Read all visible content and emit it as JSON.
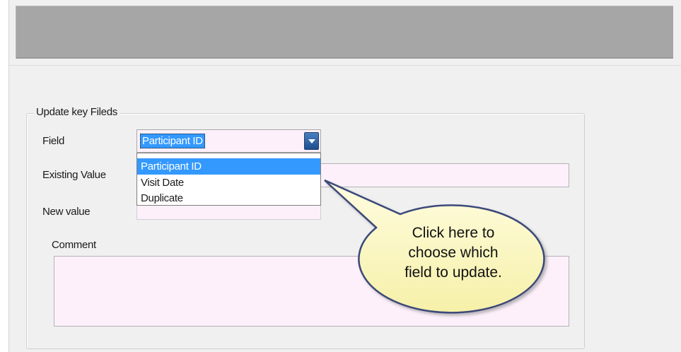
{
  "groupbox": {
    "title": "Update key Fileds"
  },
  "labels": {
    "field": "Field",
    "existing_value": "Existing Value",
    "new_value": "New value",
    "comment": "Comment"
  },
  "field_combo": {
    "selected_value": "Participant ID"
  },
  "dropdown": {
    "options": [
      "Participant ID",
      "Visit Date",
      "Duplicate"
    ],
    "highlighted_index": 0
  },
  "callout": {
    "lines": [
      "Click here to",
      "choose which",
      "field to update."
    ]
  },
  "colors": {
    "input_bg": "#fdf0fb",
    "selection": "#3399ff",
    "callout_fill": "#fffcc8",
    "header_gray": "#a6a6a6"
  }
}
